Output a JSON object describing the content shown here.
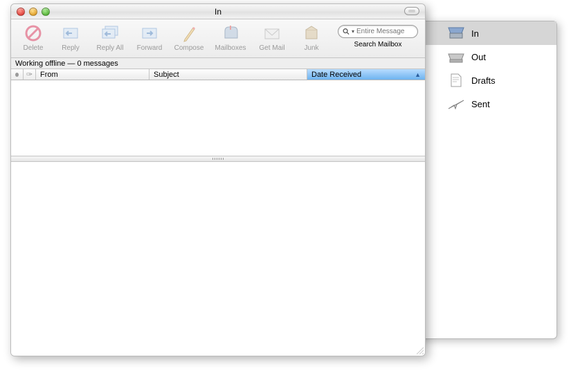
{
  "window": {
    "title": "In"
  },
  "toolbar": {
    "delete": "Delete",
    "reply": "Reply",
    "reply_all": "Reply All",
    "forward": "Forward",
    "compose": "Compose",
    "mailboxes": "Mailboxes",
    "get_mail": "Get Mail",
    "junk": "Junk"
  },
  "search": {
    "placeholder": "Entire Message",
    "label": "Search Mailbox"
  },
  "status": "Working offline — 0 messages",
  "columns": {
    "from": "From",
    "subject": "Subject",
    "date_received": "Date Received",
    "sort_column": "date_received",
    "sort_dir": "asc"
  },
  "messages": [],
  "drawer": {
    "items": [
      {
        "id": "in",
        "label": "In",
        "selected": true
      },
      {
        "id": "out",
        "label": "Out",
        "selected": false
      },
      {
        "id": "drafts",
        "label": "Drafts",
        "selected": false
      },
      {
        "id": "sent",
        "label": "Sent",
        "selected": false
      }
    ]
  }
}
